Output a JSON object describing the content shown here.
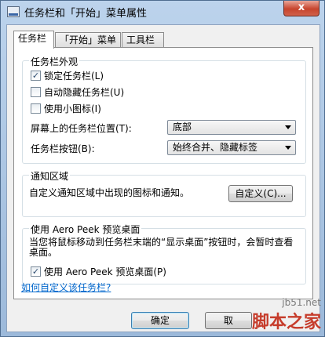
{
  "window": {
    "title": "任务栏和「开始」菜单属性",
    "close_glyph": "x"
  },
  "tabs": [
    {
      "label": "任务栏"
    },
    {
      "label": "「开始」菜单"
    },
    {
      "label": "工具栏"
    }
  ],
  "appearance": {
    "title": "任务栏外观",
    "lock": {
      "label": "锁定任务栏(L)",
      "checked": true
    },
    "autohide": {
      "label": "自动隐藏任务栏(U)",
      "checked": false
    },
    "small_icons": {
      "label": "使用小图标(I)",
      "checked": false
    },
    "location_label": "屏幕上的任务栏位置(T):",
    "location_value": "底部",
    "buttons_label": "任务栏按钮(B):",
    "buttons_value": "始终合并、隐藏标签"
  },
  "notification": {
    "title": "通知区域",
    "description": "自定义通知区域中出现的图标和通知。",
    "customize_button": "自定义(C)..."
  },
  "aero_peek": {
    "title": "使用 Aero Peek 预览桌面",
    "description": "当您将鼠标移动到任务栏末端的“显示桌面”按钮时，会暂时查看桌面。",
    "use": {
      "label": "使用 Aero Peek 预览桌面(P)",
      "checked": true
    }
  },
  "help_link": "如何自定义该任务栏?",
  "footer": {
    "ok_label": "确定",
    "cancel_label": "取"
  },
  "watermark": {
    "site": "jb51.net",
    "brand": "脚本之家"
  }
}
